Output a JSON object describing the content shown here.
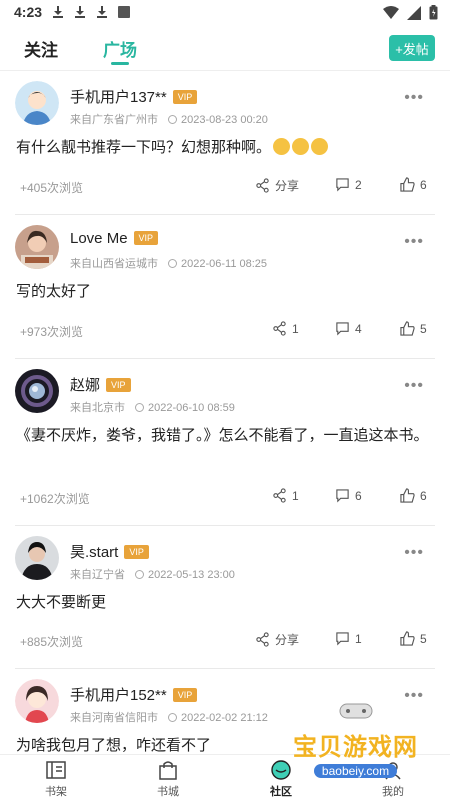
{
  "status_bar": {
    "time": "4:23"
  },
  "tabs": {
    "follow": "关注",
    "square": "广场"
  },
  "post_button": "+发帖",
  "posts": [
    {
      "username": "手机用户137**",
      "vip": "VIP",
      "location": "来自广东省广州市",
      "time": "2023-08-23 00:20",
      "content": "有什么靓书推荐一下吗？幻想那种啊。",
      "views": "+405次浏览",
      "share": "分享",
      "comments": "2",
      "likes": "6"
    },
    {
      "username": "Love Me",
      "vip": "VIP",
      "location": "来自山西省运城市",
      "time": "2022-06-11 08:25",
      "content": "写的太好了",
      "views": "+973次浏览",
      "share": "1",
      "comments": "4",
      "likes": "5"
    },
    {
      "username": "赵娜",
      "vip": "VIP",
      "location": "来自北京市",
      "time": "2022-06-10 08:59",
      "content": "《妻不厌炸，娄爷，我错了。》怎么不能看了，一直追这本书。",
      "views": "+1062次浏览",
      "share": "1",
      "comments": "6",
      "likes": "6"
    },
    {
      "username": "昊.start",
      "vip": "VIP",
      "location": "来自辽宁省",
      "time": "2022-05-13 23:00",
      "content": "大大不要断更",
      "views": "+885次浏览",
      "share": "分享",
      "comments": "1",
      "likes": "5"
    },
    {
      "username": "手机用户152**",
      "vip": "VIP",
      "location": "来自河南省信阳市",
      "time": "2022-02-02 21:12",
      "content": "为啥我包月了想，咋还看不了"
    }
  ],
  "bottom_nav": {
    "bookshelf": "书架",
    "store": "书城",
    "community": "社区",
    "mine": "我的"
  },
  "watermark": {
    "title": "宝贝游戏网",
    "url": "baobeiy.com"
  },
  "colors": {
    "accent": "#29b6a0",
    "vip": "#e8a33a"
  }
}
